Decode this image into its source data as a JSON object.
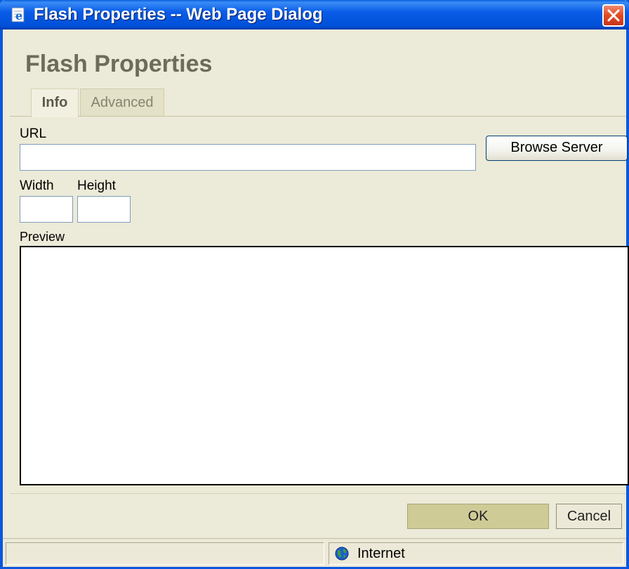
{
  "window": {
    "title": "Flash Properties -- Web Page Dialog"
  },
  "dialog": {
    "title": "Flash Properties",
    "tabs": [
      {
        "label": "Info",
        "active": true
      },
      {
        "label": "Advanced",
        "active": false
      }
    ],
    "url": {
      "label": "URL",
      "value": ""
    },
    "browse_button": "Browse Server",
    "width": {
      "label": "Width",
      "value": ""
    },
    "height": {
      "label": "Height",
      "value": ""
    },
    "preview_label": "Preview",
    "ok_button": "OK",
    "cancel_button": "Cancel"
  },
  "statusbar": {
    "zone": "Internet"
  },
  "icons": {
    "title": "ie-page-icon",
    "close": "close-icon",
    "zone": "globe-icon"
  },
  "colors": {
    "titlebar": "#0a5de8",
    "dialog_bg": "#ecead8",
    "heading": "#6b6c5c",
    "ok_button": "#cfcb97",
    "close_button": "#e04a22"
  }
}
